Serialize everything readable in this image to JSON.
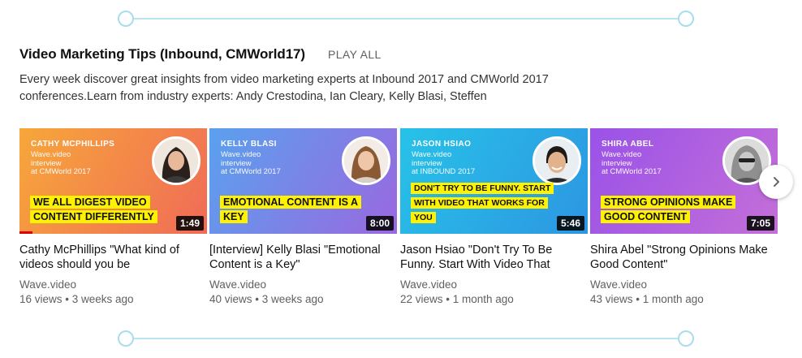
{
  "section": {
    "title": "Video Marketing Tips (Inbound, CMWorld17)",
    "play_all": "PLAY ALL",
    "description": "Every week discover great insights from video marketing experts at Inbound 2017 and CMWorld 2017 conferences.Learn from industry experts: Andy Crestodina, Ian Cleary, Kelly Blasi, Steffen"
  },
  "videos": [
    {
      "thumb_name": "CATHY MCPHILLIPS",
      "thumb_sub": "Wave.video\ninterview\nat CMWorld 2017",
      "thumb_caption": "WE ALL DIGEST VIDEO CONTENT DIFFERENTLY",
      "duration": "1:49",
      "watched_fraction": 0.07,
      "title": "Cathy McPhillips \"What kind of videos should you be",
      "channel": "Wave.video",
      "meta": "16 views • 3 weeks ago"
    },
    {
      "thumb_name": "KELLY BLASI",
      "thumb_sub": "Wave.video\ninterview\nat CMWorld 2017",
      "thumb_caption": "EMOTIONAL CONTENT IS A KEY",
      "duration": "8:00",
      "title": "[Interview] Kelly Blasi \"Emotional Content is a Key\"",
      "channel": "Wave.video",
      "meta": "40 views • 3 weeks ago"
    },
    {
      "thumb_name": "JASON HSIAO",
      "thumb_sub": "Wave.video\ninterview\nat INBOUND 2017",
      "thumb_caption": "DON'T TRY TO BE FUNNY. START WITH VIDEO THAT WORKS FOR YOU",
      "duration": "5:46",
      "title": "Jason Hsiao \"Don't Try To Be Funny. Start With Video That",
      "channel": "Wave.video",
      "meta": "22 views • 1 month ago"
    },
    {
      "thumb_name": "SHIRA ABEL",
      "thumb_sub": "Wave.video\ninterview\nat CMWorld 2017",
      "thumb_caption": "STRONG OPINIONS MAKE GOOD CONTENT",
      "duration": "7:05",
      "title": "Shira Abel \"Strong Opinions Make Good Content\"",
      "channel": "Wave.video",
      "meta": "43 views • 1 month ago"
    }
  ],
  "colors": {
    "connector": "#b9e4f1",
    "caption_highlight": "#fff200",
    "progress": "#e00000",
    "thumb_gradients": [
      [
        "#f7a73a",
        "#f06b57"
      ],
      [
        "#5aa1ee",
        "#9a68e0"
      ],
      [
        "#27c2e8",
        "#2d96e2"
      ],
      [
        "#9a52e8",
        "#c46fd8"
      ]
    ]
  },
  "icons": {
    "next": "chevron-right-icon"
  }
}
